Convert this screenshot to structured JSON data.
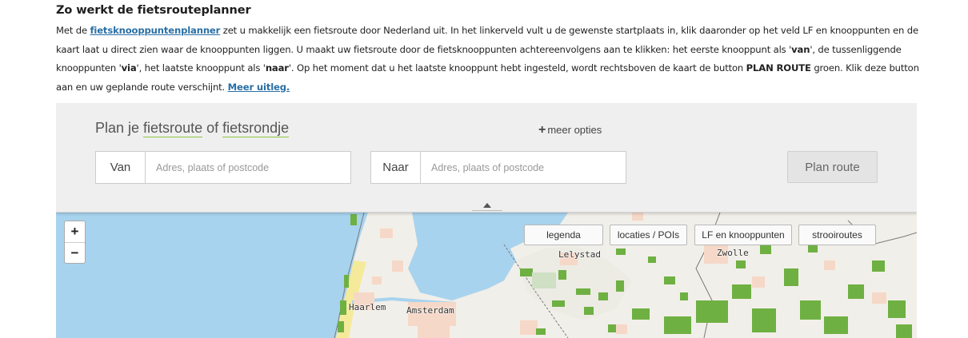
{
  "intro": {
    "heading": "Zo werkt de fietsrouteplanner",
    "p_1": "Met de ",
    "link_planner": "fietsknooppuntenplanner",
    "p_2": " zet u makkelijk een fietsroute door Nederland uit. In het linkerveld vult u de gewenste startplaats in, klik daaronder op het veld LF en knooppunten en de kaart laat u direct zien waar de knooppunten liggen. U maakt uw fietsroute door de fietsknooppunten achtereenvolgens aan te klikken: het eerste knooppunt als '",
    "b_van": "van",
    "p_3": "', de tussenliggende knooppunten '",
    "b_via": "via",
    "p_4": "', het laatste knooppunt als '",
    "b_naar": "naar",
    "p_5": "'. Op het moment dat u het laatste knooppunt hebt ingesteld, wordt rechtsboven de kaart de button ",
    "b_plan": "PLAN ROUTE",
    "p_6": " groen. Klik deze button aan en uw geplande route verschijnt. ",
    "link_meer": "Meer uitleg."
  },
  "planner": {
    "title_1": "Plan je ",
    "title_fietsroute": "fietsroute",
    "title_of": " of ",
    "title_fietsrondje": "fietsrondje",
    "meer_opties": "meer opties",
    "van_label": "Van",
    "van_placeholder": "Adres, plaats of postcode",
    "van_value": "",
    "naar_label": "Naar",
    "naar_placeholder": "Adres, plaats of postcode",
    "naar_value": "",
    "plan_button": "Plan route"
  },
  "map": {
    "zoom_in": "+",
    "zoom_out": "−",
    "buttons": {
      "legenda": "legenda",
      "locaties": "locaties / POIs",
      "lf": "LF en knooppunten",
      "strooiroutes": "strooiroutes"
    },
    "cities": {
      "lelystad": "Lelystad",
      "zwolle": "Zwolle",
      "haarlem": "Haarlem",
      "amsterdam": "Amsterdam"
    },
    "colors": {
      "water": "#a8d3ee",
      "land": "#f1efe9",
      "forest": "#6fb043",
      "urban": "#f6d8c8",
      "dunes": "#f4ea9a"
    }
  }
}
